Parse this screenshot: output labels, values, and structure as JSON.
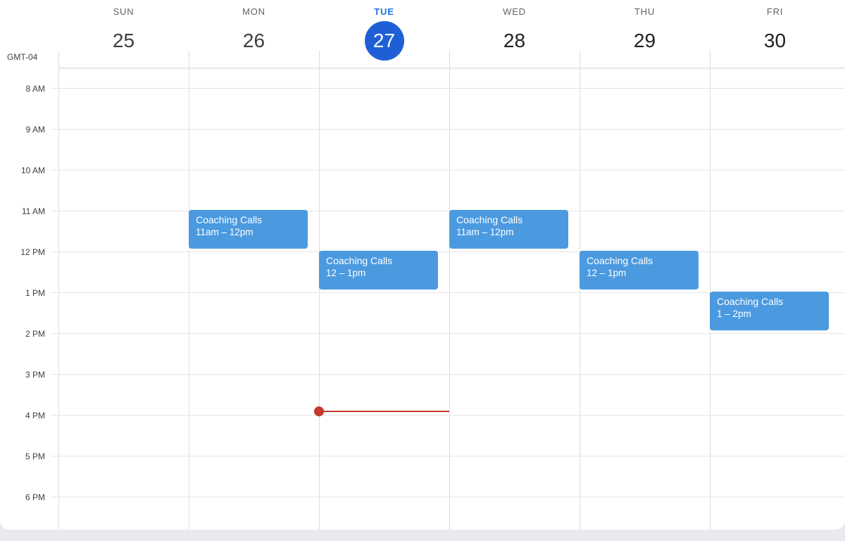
{
  "timezone": "GMT-04",
  "days": [
    {
      "name": "SUN",
      "num": "25"
    },
    {
      "name": "MON",
      "num": "26"
    },
    {
      "name": "TUE",
      "num": "27",
      "today": true
    },
    {
      "name": "WED",
      "num": "28"
    },
    {
      "name": "THU",
      "num": "29"
    },
    {
      "name": "FRI",
      "num": "30"
    }
  ],
  "hours": [
    "8 AM",
    "9 AM",
    "10 AM",
    "11 AM",
    "12 PM",
    "1 PM",
    "2 PM",
    "3 PM",
    "4 PM",
    "5 PM",
    "6 PM"
  ],
  "events": [
    {
      "day": "MON",
      "title": "Coaching Calls",
      "time": "11am – 12pm"
    },
    {
      "day": "TUE",
      "title": "Coaching Calls",
      "time": "12 – 1pm"
    },
    {
      "day": "WED",
      "title": "Coaching Calls",
      "time": "11am – 12pm"
    },
    {
      "day": "THU",
      "title": "Coaching Calls",
      "time": "12 – 1pm"
    },
    {
      "day": "FRI",
      "title": "Coaching Calls",
      "time": "1 – 2pm"
    }
  ],
  "colors": {
    "event": "#4b9ae0",
    "today_accent": "#1f5fd6",
    "now_indicator": "#c5392c"
  }
}
